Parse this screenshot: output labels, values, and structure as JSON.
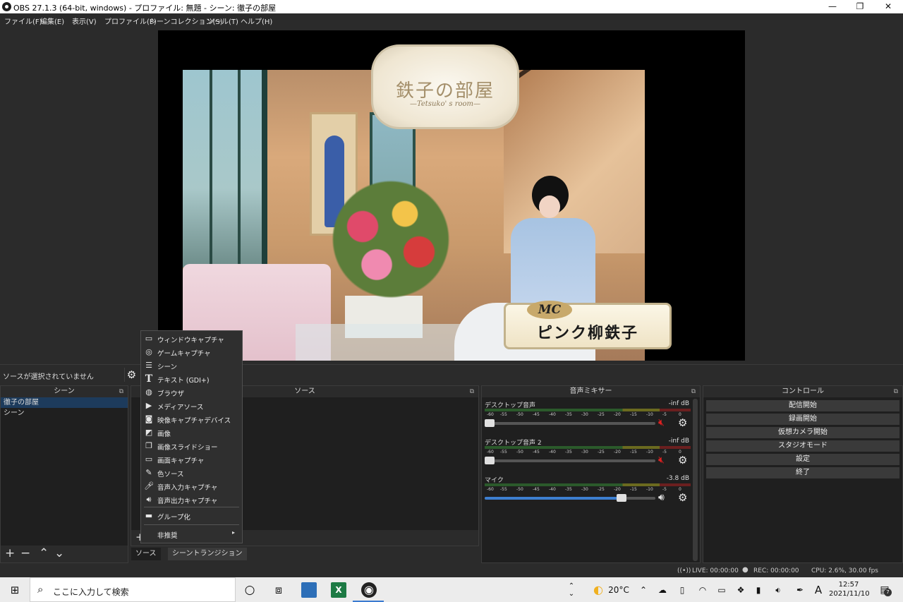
{
  "window": {
    "title": "OBS 27.1.3 (64-bit, windows) - プロファイル: 無題 - シーン: 徹子の部屋",
    "minimize": "—",
    "restore": "❐",
    "close": "✕"
  },
  "menu": [
    "ファイル(F)",
    "編集(E)",
    "表示(V)",
    "プロファイル(P)",
    "シーンコレクション(S)",
    "ツール(T)",
    "ヘルプ(H)"
  ],
  "preview": {
    "logo_title": "鉄子の部屋",
    "logo_subtitle": "—Tetsuko' s room—",
    "mc_label": "MC",
    "mc_name": "ピンク柳鉄子"
  },
  "source_bar": {
    "no_source": "ソースが選択されていません"
  },
  "scenes": {
    "header": "シーン",
    "items": [
      "徹子の部屋",
      "シーン"
    ]
  },
  "sources": {
    "header": "ソース",
    "visibility": [
      true,
      true,
      false,
      true,
      true,
      true,
      true,
      true,
      true
    ]
  },
  "tabs": [
    "ソース",
    "シーントランジション"
  ],
  "mixer": {
    "header": "音声ミキサー",
    "channels": [
      {
        "name": "デスクトップ音声",
        "db": "-inf dB",
        "muted": true,
        "level": 0.02
      },
      {
        "name": "デスクトップ音声 2",
        "db": "-inf dB",
        "muted": true,
        "level": 0.02
      },
      {
        "name": "マイク",
        "db": "-3.8 dB",
        "muted": false,
        "level": 0.8
      }
    ],
    "ticks": [
      "-60",
      "-55",
      "-50",
      "-45",
      "-40",
      "-35",
      "-30",
      "-25",
      "-20",
      "-15",
      "-10",
      "-5",
      "0"
    ]
  },
  "controls": {
    "header": "コントロール",
    "buttons": [
      "配信開始",
      "録画開始",
      "仮想カメラ開始",
      "スタジオモード",
      "設定",
      "終了"
    ]
  },
  "context_menu": {
    "items": [
      "ウィンドウキャプチャ",
      "ゲームキャプチャ",
      "シーン",
      "テキスト (GDI+)",
      "ブラウザ",
      "メディアソース",
      "映像キャプチャデバイス",
      "画像",
      "画像スライドショー",
      "画面キャプチャ",
      "色ソース",
      "音声入力キャプチャ",
      "音声出力キャプチャ"
    ],
    "group": "グループ化",
    "deprecated": "非推奨"
  },
  "status": {
    "live": "LIVE: 00:00:00",
    "rec": "REC: 00:00:00",
    "cpu": "CPU: 2.6%, 30.00 fps"
  },
  "taskbar": {
    "search_placeholder": "ここに入力して検索",
    "weather": "20°C",
    "ime": "A",
    "time": "12:57",
    "date": "2021/11/10",
    "notifications": "7"
  }
}
